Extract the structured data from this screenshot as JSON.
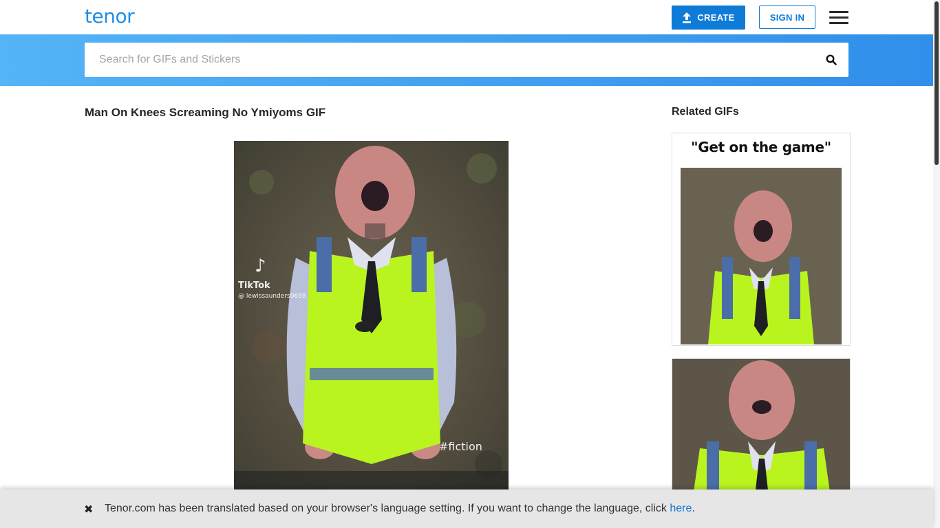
{
  "header": {
    "logo_text": "tenor",
    "create_label": "CREATE",
    "signin_label": "SIGN IN",
    "menu_icon": "hamburger-menu-icon",
    "brand_color": "#0e7bd7"
  },
  "search": {
    "placeholder": "Search for GIFs and Stickers",
    "value": "",
    "icon": "search-icon"
  },
  "main": {
    "title": "Man On Knees Screaming No Ymiyoms GIF",
    "gif_overlay": {
      "watermark_brand": "TikTok",
      "watermark_user": "@ lewissaunders0658",
      "hashtag": "#fiction"
    }
  },
  "related": {
    "title": "Related GIFs",
    "items": [
      {
        "caption": "\"Get on the game\""
      },
      {
        "caption": ""
      }
    ]
  },
  "banner": {
    "text_before": "Tenor.com has been translated based on your browser's language setting. If you want to change the language, click ",
    "link_text": "here",
    "text_after": ".",
    "close_icon": "close-icon",
    "link_color": "#1576d2"
  }
}
